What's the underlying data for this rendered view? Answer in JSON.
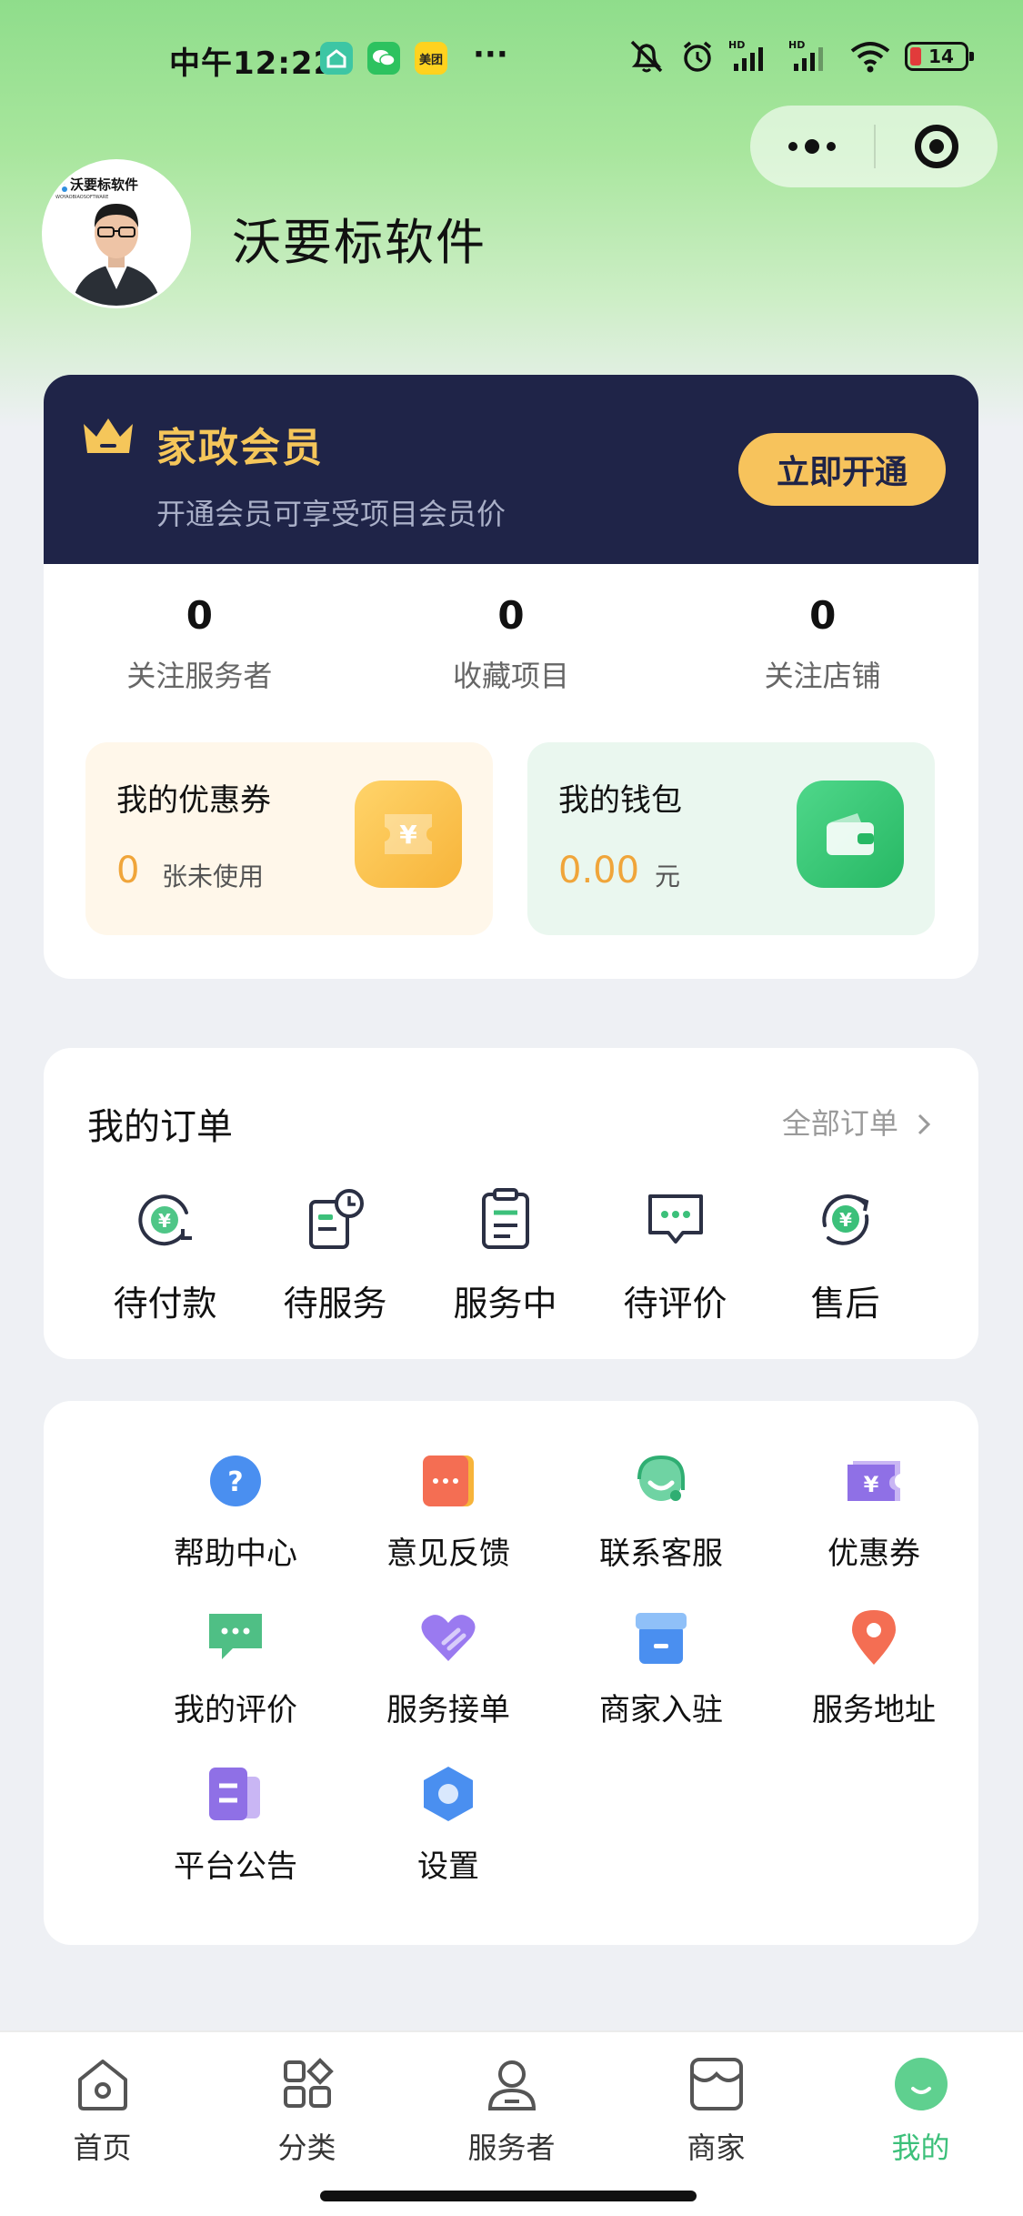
{
  "status_bar": {
    "time": "中午12:22",
    "more": "···",
    "battery": "14",
    "apps": [
      "home-app-icon",
      "wechat-icon",
      "meituan-icon"
    ],
    "meituan_text": "美团"
  },
  "capsule": {
    "more_icon": "more-dots-icon",
    "close_icon": "target-close-icon"
  },
  "profile": {
    "nickname": "沃要标软件",
    "avatar_logo_text": "沃要标软件",
    "avatar_logo_sub": "WOYAOBIAOSOFTWARE"
  },
  "member": {
    "title": "家政会员",
    "subtitle": "开通会员可享受项目会员价",
    "button": "立即开通",
    "colors": {
      "bg": "#1f2448",
      "gold": "#f5c65a",
      "button": "#f7c35c"
    }
  },
  "stats": [
    {
      "value": "0",
      "label": "关注服务者"
    },
    {
      "value": "0",
      "label": "收藏项目"
    },
    {
      "value": "0",
      "label": "关注店铺"
    }
  ],
  "coupon": {
    "title": "我的优惠券",
    "value": "0",
    "unit": "张未使用",
    "icon": "ticket-yen-icon"
  },
  "wallet": {
    "title": "我的钱包",
    "value": "0.00",
    "unit": "元",
    "icon": "wallet-icon"
  },
  "orders": {
    "title": "我的订单",
    "all": "全部订单",
    "items": [
      {
        "label": "待付款",
        "icon": "yen-refresh-icon"
      },
      {
        "label": "待服务",
        "icon": "doc-clock-icon"
      },
      {
        "label": "服务中",
        "icon": "clipboard-icon"
      },
      {
        "label": "待评价",
        "icon": "chat-dots-icon"
      },
      {
        "label": "售后",
        "icon": "yen-cycle-icon"
      }
    ]
  },
  "tools": [
    {
      "label": "帮助中心",
      "icon": "help-icon"
    },
    {
      "label": "意见反馈",
      "icon": "feedback-icon"
    },
    {
      "label": "联系客服",
      "icon": "headset-icon"
    },
    {
      "label": "优惠券",
      "icon": "coupon-icon"
    },
    {
      "label": "我的评价",
      "icon": "comment-icon"
    },
    {
      "label": "服务接单",
      "icon": "heart-handshake-icon"
    },
    {
      "label": "商家入驻",
      "icon": "store-icon"
    },
    {
      "label": "服务地址",
      "icon": "location-pin-icon"
    },
    {
      "label": "平台公告",
      "icon": "notice-icon"
    },
    {
      "label": "设置",
      "icon": "settings-icon"
    }
  ],
  "tabbar": [
    {
      "label": "首页",
      "icon": "home-icon"
    },
    {
      "label": "分类",
      "icon": "category-icon"
    },
    {
      "label": "服务者",
      "icon": "worker-icon"
    },
    {
      "label": "商家",
      "icon": "shop-icon"
    },
    {
      "label": "我的",
      "icon": "me-icon",
      "active": true
    }
  ]
}
